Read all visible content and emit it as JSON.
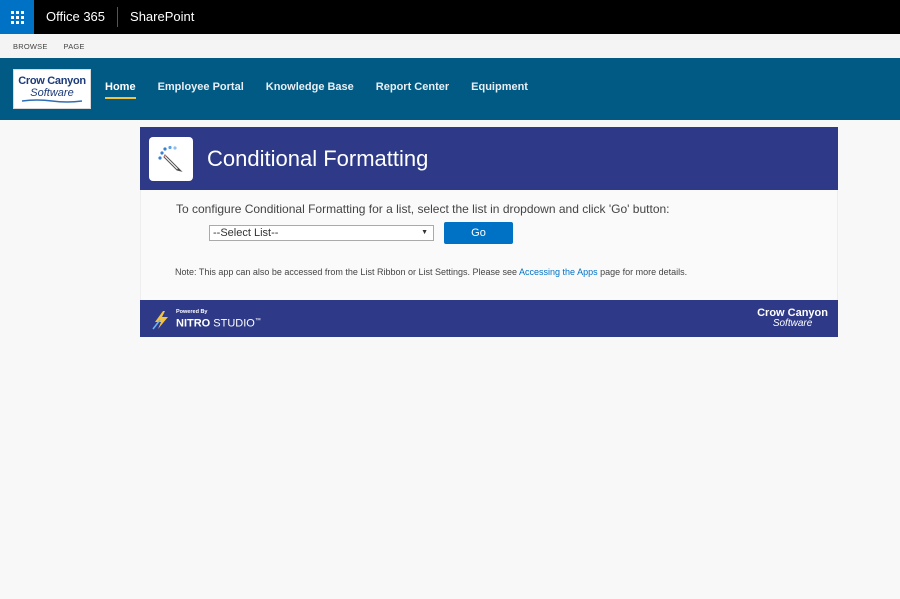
{
  "suite": {
    "app_launcher": "app-launcher",
    "brand": "Office 365",
    "product": "SharePoint"
  },
  "ribbon": {
    "tabs": [
      "BROWSE",
      "PAGE"
    ]
  },
  "header": {
    "logo_line1": "Crow Canyon",
    "logo_line2": "Software",
    "nav": [
      {
        "label": "Home",
        "active": true
      },
      {
        "label": "Employee Portal",
        "active": false
      },
      {
        "label": "Knowledge Base",
        "active": false
      },
      {
        "label": "Report Center",
        "active": false
      },
      {
        "label": "Equipment",
        "active": false
      }
    ]
  },
  "panel": {
    "title": "Conditional Formatting",
    "instruction": "To configure Conditional Formatting for a list, select the list in dropdown and click 'Go' button:",
    "select_value": "--Select List--",
    "go_label": "Go",
    "note_prefix": "Note: This app can also be accessed from the List Ribbon or List Settings. Please see ",
    "note_link": "Accessing the Apps",
    "note_suffix": " page for more details."
  },
  "footer": {
    "powered_by": "Powered By",
    "nitro_bold": "NITRO",
    "nitro_rest": " STUDIO",
    "tm": "™",
    "logo_line1": "Crow Canyon",
    "logo_line2": "Software"
  },
  "colors": {
    "suite_bar": "#000000",
    "launcher": "#0072c6",
    "nav_bar": "#005a84",
    "panel_header": "#2e3a87",
    "accent_underline": "#f4c242",
    "link": "#0072c6"
  }
}
